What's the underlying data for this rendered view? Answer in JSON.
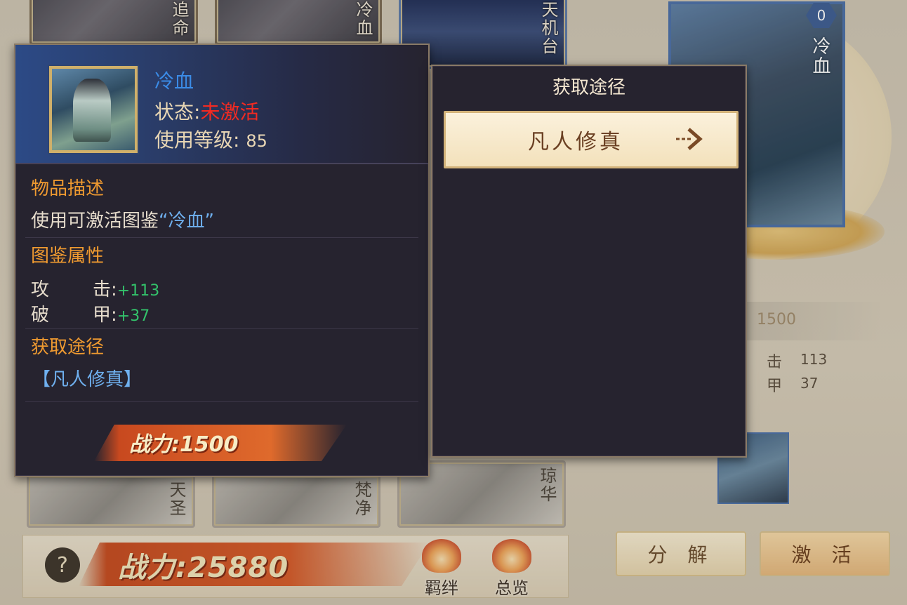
{
  "background": {
    "top_cards": [
      "追命",
      "冷血",
      "天机台"
    ],
    "bottom_cards": [
      "天圣",
      "梵净",
      "琼华"
    ],
    "hero": {
      "name": "冷血",
      "badge": "0"
    },
    "stats": {
      "power": "1500",
      "attr1_label": "击",
      "attr1_value": "113",
      "attr2_label": "甲",
      "attr2_value": "37"
    },
    "buttons": {
      "decompose": "分 解",
      "activate": "激 活"
    },
    "bottom_bar": {
      "help": "?",
      "total_power": "战力:25880",
      "bond_label": "羁绊",
      "overview_label": "总览"
    }
  },
  "item_popup": {
    "name": "冷血",
    "status_label": "状态:",
    "status_value": "未激活",
    "level_label": "使用等级:",
    "level_value": "85",
    "desc_title": "物品描述",
    "desc_prefix": "使用可激活图鉴",
    "desc_highlight": "“冷血”",
    "attr_title": "图鉴属性",
    "attributes": [
      {
        "k1": "攻",
        "k2": "击:",
        "value": "+113"
      },
      {
        "k1": "破",
        "k2": "甲:",
        "value": "+37"
      }
    ],
    "source_title": "获取途径",
    "source_link": "【凡人修真】",
    "power": "战力:1500"
  },
  "source_popup": {
    "title": "获取途径",
    "entries": [
      "凡人修真"
    ]
  },
  "colors": {
    "name_blue": "#3b8be6",
    "inactive_red": "#f22a22",
    "section_orange": "#ef9a30",
    "attr_green": "#33c36b"
  }
}
